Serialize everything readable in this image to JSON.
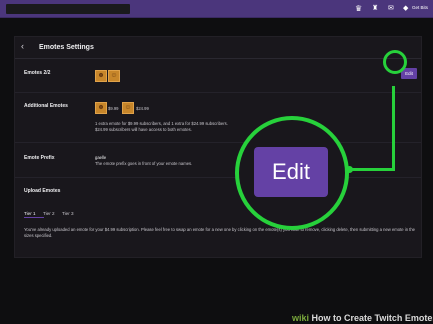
{
  "topbar": {
    "crown_icon": "crown-icon",
    "bits_label": "Get Bits"
  },
  "panel": {
    "back_icon": "‹",
    "title": "Emotes Settings",
    "emotes_label": "Emotes 2/2",
    "edit_label": "Edit",
    "additional_label": "Additional Emotes",
    "price1": "$9.99",
    "price2": "$24.99",
    "additional_note1": "1 extra emote for $9.99 subscribers, and 1 extra for $24.99 subscribers.",
    "additional_note2": "$24.99 subscribers will have access to both emotes.",
    "prefix_label": "Emote Prefix",
    "prefix_value": "gaelle",
    "prefix_note": "The emote prefix goes in front of your emote names.",
    "upload_label": "Upload Emotes",
    "tabs": [
      "Tier 1",
      "Tier 2",
      "Tier 3"
    ],
    "note": "You've already uploaded an emote for your $4.99 subscription. Please feel free to swap an emote for a new one by clicking on the emote(s) you wish to remove, clicking delete, then submitting a new emote in the sizes specified."
  },
  "callout": {
    "edit_label": "Edit"
  },
  "watermark": {
    "wiki": "wiki",
    "text": "How to Create Twitch Emotes"
  },
  "colors": {
    "accent": "#6441a5",
    "highlight": "#27d13b",
    "topbar": "#4b367c"
  }
}
